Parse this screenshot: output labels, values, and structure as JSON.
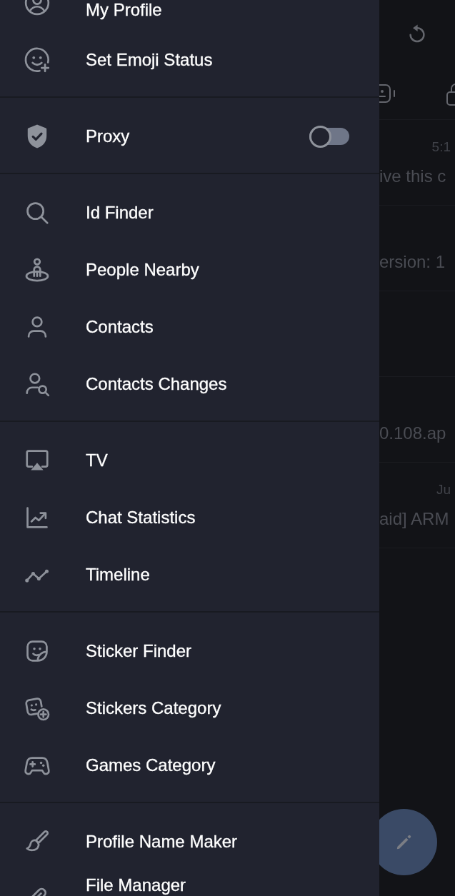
{
  "drawer": {
    "sections": [
      {
        "items": [
          {
            "label": "My Profile",
            "kind": "plain"
          },
          {
            "label": "Set Emoji Status",
            "kind": "plain"
          }
        ]
      },
      {
        "items": [
          {
            "label": "Proxy",
            "kind": "toggle",
            "on": false
          }
        ]
      },
      {
        "items": [
          {
            "label": "Id Finder",
            "kind": "plain"
          },
          {
            "label": "People Nearby",
            "kind": "plain"
          },
          {
            "label": "Contacts",
            "kind": "plain"
          },
          {
            "label": "Contacts Changes",
            "kind": "plain"
          }
        ]
      },
      {
        "items": [
          {
            "label": "TV",
            "kind": "plain"
          },
          {
            "label": "Chat Statistics",
            "kind": "plain"
          },
          {
            "label": "Timeline",
            "kind": "plain"
          }
        ]
      },
      {
        "items": [
          {
            "label": "Sticker Finder",
            "kind": "plain"
          },
          {
            "label": "Stickers Category",
            "kind": "plain"
          },
          {
            "label": "Games Category",
            "kind": "plain"
          }
        ]
      },
      {
        "items": [
          {
            "label": "Profile Name Maker",
            "kind": "plain"
          },
          {
            "label": "File Manager",
            "kind": "plain"
          }
        ]
      }
    ]
  },
  "chat_list": {
    "rows": [
      {
        "time": "5:1",
        "preview": "ive this c"
      },
      {
        "preview": "ersion: 1"
      },
      {},
      {
        "preview": "0.108.ap"
      },
      {
        "time": "Ju",
        "preview": "aid] ARM"
      }
    ]
  }
}
